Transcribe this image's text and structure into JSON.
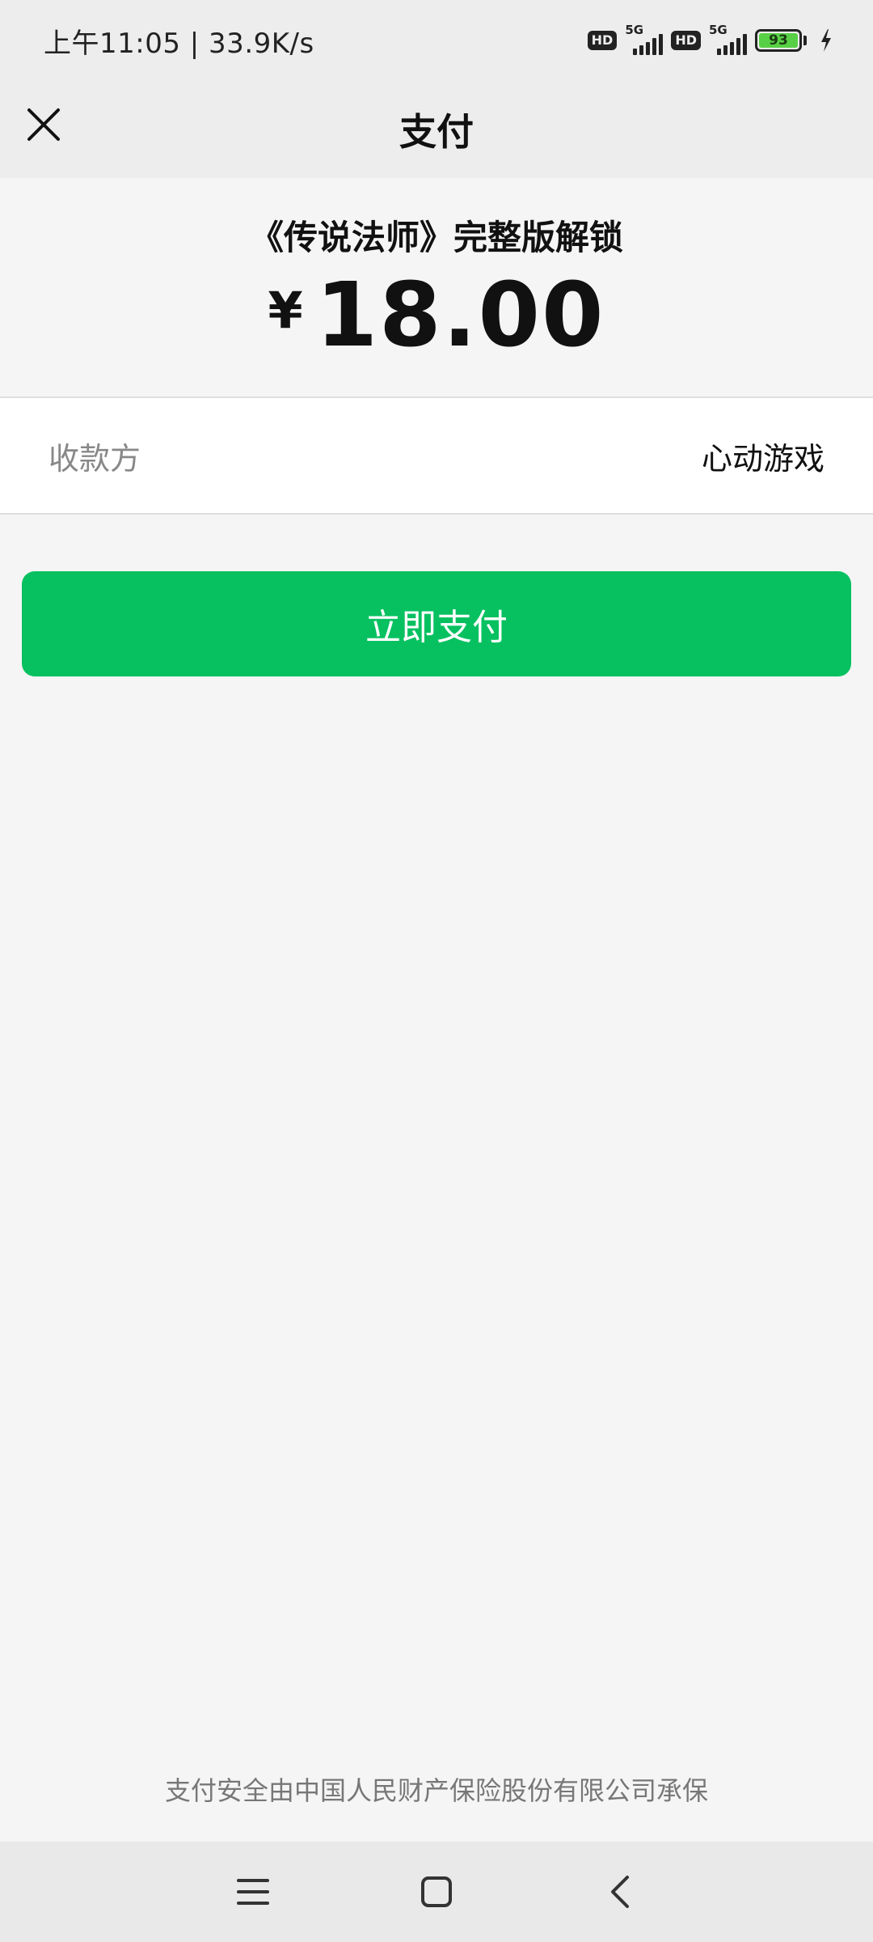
{
  "status_bar": {
    "time_speed": "上午11:05 | 33.9K/s",
    "hd1": "HD",
    "net1": "5G",
    "hd2": "HD",
    "net2": "5G",
    "battery": "93",
    "battery_level": 0.93,
    "icons": [
      "hd-icon",
      "signal-5g-icon",
      "hd-icon",
      "signal-5g-icon",
      "battery-icon",
      "charging-icon"
    ]
  },
  "header": {
    "title": "支付",
    "close_icon": "close-icon"
  },
  "product": {
    "name": "《传说法师》完整版解锁",
    "currency_symbol": "¥",
    "amount": "18.00"
  },
  "payee": {
    "label": "收款方",
    "value": "心动游戏"
  },
  "pay_button": {
    "label": "立即支付"
  },
  "footer": {
    "note": "支付安全由中国人民财产保险股份有限公司承保"
  },
  "nav_bar": {
    "icons": [
      "menu-icon",
      "home-icon",
      "back-icon"
    ]
  },
  "colors": {
    "accent_green": "#07c160",
    "battery_green": "#58d046",
    "header_bg": "#ededed",
    "page_bg": "#f5f5f5"
  }
}
